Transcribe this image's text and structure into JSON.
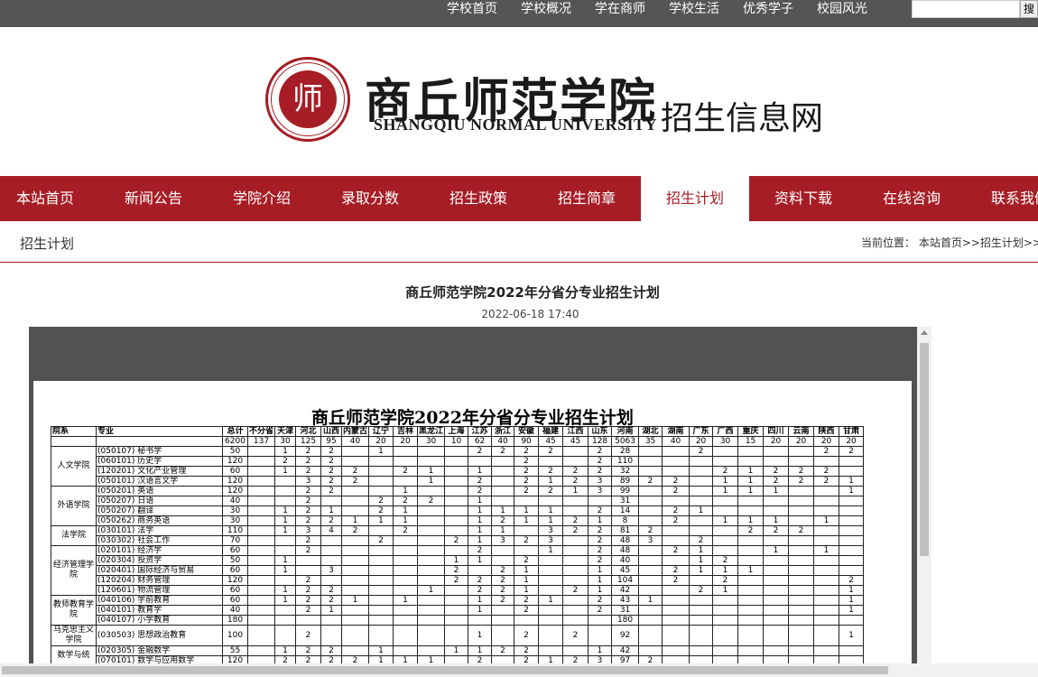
{
  "topbar": {
    "links": [
      "学校首页",
      "学校概况",
      "学在商师",
      "学校生活",
      "优秀学子",
      "校园风光"
    ],
    "search_button": "搜"
  },
  "header": {
    "logo_seal_text": "师",
    "logo_cn": "商丘师范学院",
    "logo_en": "SHANGQIU NORMAL UNIVERSITY",
    "site_name": "招生信息网"
  },
  "nav": {
    "items": [
      "本站首页",
      "新闻公告",
      "学院介绍",
      "录取分数",
      "招生政策",
      "招生简章",
      "招生计划",
      "资料下载",
      "在线咨询",
      "联系我们"
    ],
    "active_index": 6
  },
  "breadcrumb": {
    "title": "招生计划",
    "path": "当前位置： 本站首页>>招生计划>>正文"
  },
  "article": {
    "title": "商丘师范学院2022年分省分专业招生计划",
    "date": "2022-06-18 17:40"
  },
  "document": {
    "title": "商丘师范学院2022年分省分专业招生计划",
    "header": [
      "院系",
      "专业",
      "总计",
      "不分省",
      "天津",
      "河北",
      "山西",
      "内蒙古",
      "辽宁",
      "吉林",
      "黑龙江",
      "上海",
      "江苏",
      "浙江",
      "安徽",
      "福建",
      "江西",
      "山东",
      "河南",
      "湖北",
      "湖南",
      "广东",
      "广西",
      "重庆",
      "四川",
      "云南",
      "陕西",
      "甘肃"
    ],
    "totals": [
      "",
      "",
      "6200",
      "137",
      "30",
      "125",
      "95",
      "40",
      "20",
      "20",
      "30",
      "10",
      "62",
      "40",
      "90",
      "45",
      "45",
      "128",
      "5063",
      "35",
      "40",
      "20",
      "30",
      "15",
      "20",
      "20",
      "20",
      "20"
    ],
    "groups": [
      {
        "college": "人文学院",
        "rows": [
          [
            "(050107) 秘书学",
            "50",
            "",
            "1",
            "2",
            "2",
            "",
            "1",
            "",
            "",
            "",
            "2",
            "2",
            "2",
            "2",
            "",
            "2",
            "28",
            "",
            "",
            "2",
            "",
            "",
            "",
            "",
            "2",
            "2"
          ],
          [
            "(060101) 历史学",
            "120",
            "",
            "2",
            "2",
            "2",
            "",
            "",
            "",
            "",
            "",
            "",
            "",
            "2",
            "",
            "",
            "2",
            "110",
            "",
            "",
            "",
            "",
            "",
            "",
            "",
            "",
            ""
          ],
          [
            "(120201) 文化产业管理",
            "60",
            "",
            "1",
            "2",
            "2",
            "2",
            "",
            "2",
            "1",
            "",
            "1",
            "",
            "2",
            "2",
            "2",
            "2",
            "32",
            "",
            "",
            "",
            "2",
            "1",
            "2",
            "2",
            "2",
            ""
          ],
          [
            "(050101) 汉语言文学",
            "120",
            "",
            "",
            "3",
            "2",
            "2",
            "",
            "",
            "1",
            "",
            "2",
            "",
            "2",
            "1",
            "2",
            "3",
            "89",
            "2",
            "2",
            "",
            "1",
            "1",
            "2",
            "2",
            "2",
            "1"
          ]
        ]
      },
      {
        "college": "外语学院",
        "rows": [
          [
            "(050201) 英语",
            "120",
            "",
            "",
            "2",
            "2",
            "",
            "",
            "1",
            "",
            "",
            "2",
            "",
            "2",
            "2",
            "1",
            "3",
            "99",
            "",
            "2",
            "",
            "1",
            "1",
            "1",
            "",
            "",
            "1"
          ],
          [
            "(050207) 日语",
            "40",
            "",
            "",
            "2",
            "",
            "",
            "2",
            "2",
            "2",
            "",
            "1",
            "",
            "",
            "",
            "",
            "",
            "31",
            "",
            "",
            "",
            "",
            "",
            "",
            "",
            "",
            ""
          ],
          [
            "(050207) 翻译",
            "30",
            "",
            "1",
            "2",
            "1",
            "",
            "2",
            "1",
            "",
            "",
            "1",
            "1",
            "1",
            "1",
            "",
            "2",
            "14",
            "",
            "2",
            "1",
            "",
            "",
            "",
            "",
            "",
            ""
          ],
          [
            "(050262) 商务英语",
            "30",
            "",
            "1",
            "2",
            "2",
            "1",
            "1",
            "1",
            "",
            "",
            "1",
            "2",
            "1",
            "1",
            "2",
            "1",
            "8",
            "",
            "2",
            "",
            "1",
            "1",
            "1",
            "",
            "1",
            ""
          ]
        ]
      },
      {
        "college": "法学院",
        "rows": [
          [
            "(030101) 法学",
            "110",
            "",
            "1",
            "3",
            "4",
            "2",
            "",
            "2",
            "",
            "",
            "1",
            "1",
            "",
            "3",
            "2",
            "2",
            "81",
            "2",
            "",
            "",
            "",
            "2",
            "2",
            "2",
            "",
            ""
          ],
          [
            "(030302) 社会工作",
            "70",
            "",
            "",
            "2",
            "",
            "",
            "2",
            "",
            "",
            "2",
            "1",
            "3",
            "2",
            "3",
            "",
            "2",
            "48",
            "3",
            "",
            "2",
            "",
            "",
            "",
            "",
            "",
            ""
          ]
        ]
      },
      {
        "college": "经济管理学院",
        "rows": [
          [
            "(020101) 经济学",
            "60",
            "",
            "",
            "2",
            "",
            "",
            "",
            "",
            "",
            "",
            "2",
            "",
            "",
            "1",
            "",
            "2",
            "48",
            "",
            "2",
            "1",
            "",
            "",
            "1",
            "",
            "1",
            ""
          ],
          [
            "(020304) 投资学",
            "50",
            "",
            "1",
            "",
            "",
            "",
            "",
            "",
            "",
            "1",
            "1",
            "",
            "2",
            "",
            "",
            "2",
            "40",
            "",
            "",
            "1",
            "2",
            "",
            "",
            "",
            "",
            ""
          ],
          [
            "(020401) 国际经济与贸易",
            "60",
            "",
            "1",
            "",
            "3",
            "",
            "",
            "",
            "",
            "2",
            "",
            "2",
            "1",
            "",
            "",
            "1",
            "45",
            "",
            "2",
            "1",
            "1",
            "1",
            "",
            "",
            "",
            ""
          ],
          [
            "(120204) 财务管理",
            "120",
            "",
            "",
            "2",
            "",
            "",
            "",
            "",
            "",
            "2",
            "2",
            "2",
            "1",
            "",
            "",
            "1",
            "104",
            "",
            "2",
            "",
            "2",
            "",
            "",
            "",
            "",
            "2"
          ],
          [
            "(120601) 物流管理",
            "60",
            "",
            "1",
            "2",
            "2",
            "",
            "",
            "",
            "1",
            "",
            "2",
            "2",
            "1",
            "",
            "2",
            "1",
            "42",
            "",
            "",
            "2",
            "1",
            "",
            "",
            "",
            "",
            "1"
          ]
        ]
      },
      {
        "college": "教师教育学院",
        "rows": [
          [
            "(040106) 学前教育",
            "60",
            "",
            "1",
            "2",
            "2",
            "1",
            "",
            "1",
            "",
            "",
            "1",
            "2",
            "2",
            "1",
            "",
            "2",
            "43",
            "1",
            "",
            "",
            "",
            "",
            "",
            "",
            "",
            "1"
          ],
          [
            "(040101) 教育学",
            "40",
            "",
            "",
            "2",
            "1",
            "",
            "",
            "",
            "",
            "",
            "1",
            "",
            "2",
            "",
            "",
            "2",
            "31",
            "",
            "",
            "",
            "",
            "",
            "",
            "",
            "",
            "1"
          ],
          [
            "(040107) 小学教育",
            "180",
            "",
            "",
            "",
            "",
            "",
            "",
            "",
            "",
            "",
            "",
            "",
            "",
            "",
            "",
            "",
            "180",
            "",
            "",
            "",
            "",
            "",
            "",
            "",
            "",
            ""
          ]
        ]
      },
      {
        "college": "马克思主义学院",
        "rows": [
          [
            "(030503) 思想政治教育",
            "100",
            "",
            "",
            "2",
            "",
            "",
            "",
            "",
            "",
            "",
            "1",
            "",
            "2",
            "",
            "2",
            "",
            "92",
            "",
            "",
            "",
            "",
            "",
            "",
            "",
            "",
            "1"
          ]
        ]
      },
      {
        "college": "数学与统",
        "rows": [
          [
            "(020305) 金融数学",
            "55",
            "",
            "1",
            "2",
            "2",
            "",
            "1",
            "",
            "",
            "1",
            "1",
            "2",
            "2",
            "",
            "",
            "1",
            "42",
            "",
            "",
            "",
            "",
            "",
            "",
            "",
            "",
            ""
          ],
          [
            "(070101) 数学与应用数学",
            "120",
            "",
            "2",
            "2",
            "2",
            "2",
            "1",
            "1",
            "1",
            "",
            "2",
            "",
            "2",
            "1",
            "2",
            "3",
            "97",
            "2",
            "",
            "",
            "",
            "",
            "",
            "",
            "",
            ""
          ]
        ]
      }
    ]
  }
}
